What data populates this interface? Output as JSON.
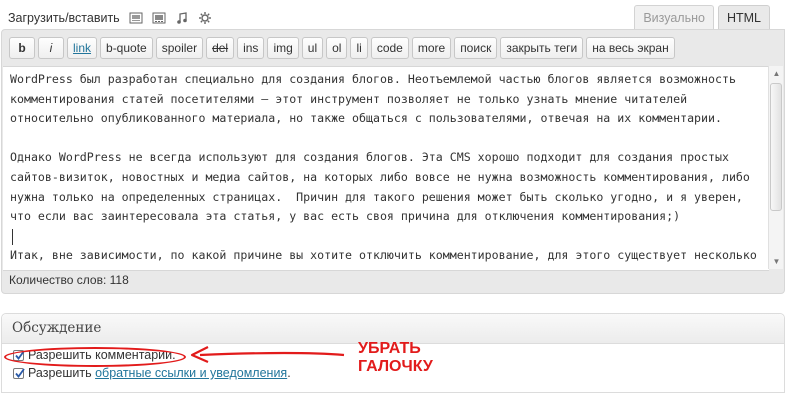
{
  "media_bar": {
    "label": "Загрузить/вставить",
    "icons": [
      "image-icon",
      "video-icon",
      "audio-icon",
      "media-icon"
    ]
  },
  "tabs": {
    "visual": "Визуально",
    "html": "HTML",
    "active": "html"
  },
  "quicktags": [
    {
      "label": "b",
      "style": "b"
    },
    {
      "label": "i",
      "style": "i"
    },
    {
      "label": "link",
      "style": "link"
    },
    {
      "label": "b-quote",
      "style": ""
    },
    {
      "label": "spoiler",
      "style": ""
    },
    {
      "label": "del",
      "style": "del"
    },
    {
      "label": "ins",
      "style": ""
    },
    {
      "label": "img",
      "style": ""
    },
    {
      "label": "ul",
      "style": ""
    },
    {
      "label": "ol",
      "style": ""
    },
    {
      "label": "li",
      "style": ""
    },
    {
      "label": "code",
      "style": ""
    },
    {
      "label": "more",
      "style": ""
    },
    {
      "label": "поиск",
      "style": ""
    },
    {
      "label": "закрыть теги",
      "style": ""
    },
    {
      "label": "на весь экран",
      "style": ""
    }
  ],
  "editor": {
    "paragraph1": "WordPress был разработан специально для создания блогов. Неотъемлемой частью блогов является возможность\nкомментирования статей посетителями – этот инструмент позволяет не только узнать мнение читателей\nотносительно опубликованного материала, но также общаться с пользователями, отвечая на их комментарии.",
    "paragraph2": "Однако WordPress не всегда используют для создания блогов. Эта CMS хорошо подходит для создания простых\nсайтов-визиток, новостных и медиа сайтов, на которых либо вовсе не нужна возможность комментирования, либо\nнужна только на определенных страницах.  Причин для такого решения может быть сколько угодно, и я уверен,\nчто если вас заинтересовала эта статья, у вас есть своя причина для отключения комментирования;)",
    "paragraph3": "Итак, вне зависимости, по какой причине вы хотите отключить комментирование, для этого существует несколько",
    "word_count": "Количество слов: 118"
  },
  "discussion": {
    "title": "Обсуждение",
    "options": [
      {
        "label": "Разрешить комментарии.",
        "checked": true
      },
      {
        "label_prefix": "Разрешить ",
        "link": "обратные ссылки и уведомления",
        "suffix": ".",
        "checked": true
      }
    ]
  },
  "annotation": {
    "line1": "УБРАТЬ",
    "line2": "ГАЛОЧКУ",
    "color": "#e21b1b"
  },
  "colors": {
    "link": "#21759b",
    "annotation": "#e21b1b"
  }
}
